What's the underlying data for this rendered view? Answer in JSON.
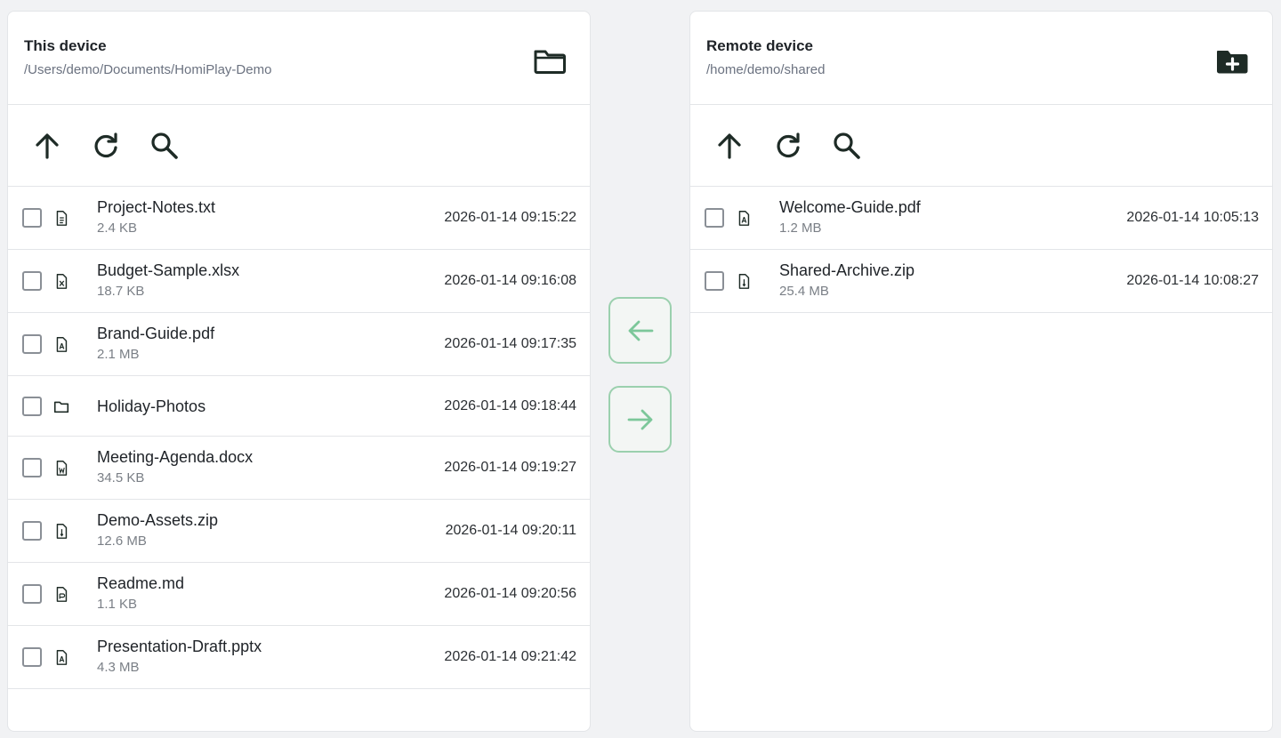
{
  "local": {
    "title": "This device",
    "path": "/Users/demo/Documents/HomiPlay-Demo",
    "files": [
      {
        "name": "Project-Notes.txt",
        "size": "2.4 KB",
        "date": "2026-01-14 09:15:22",
        "icon": "text-file-icon"
      },
      {
        "name": "Budget-Sample.xlsx",
        "size": "18.7 KB",
        "date": "2026-01-14 09:16:08",
        "icon": "spreadsheet-file-icon"
      },
      {
        "name": "Brand-Guide.pdf",
        "size": "2.1 MB",
        "date": "2026-01-14 09:17:35",
        "icon": "pdf-file-icon"
      },
      {
        "name": "Holiday-Photos",
        "size": "",
        "date": "2026-01-14 09:18:44",
        "icon": "folder-icon"
      },
      {
        "name": "Meeting-Agenda.docx",
        "size": "34.5 KB",
        "date": "2026-01-14 09:19:27",
        "icon": "word-file-icon"
      },
      {
        "name": "Demo-Assets.zip",
        "size": "12.6 MB",
        "date": "2026-01-14 09:20:11",
        "icon": "zip-file-icon"
      },
      {
        "name": "Readme.md",
        "size": "1.1 KB",
        "date": "2026-01-14 09:20:56",
        "icon": "markdown-file-icon"
      },
      {
        "name": "Presentation-Draft.pptx",
        "size": "4.3 MB",
        "date": "2026-01-14 09:21:42",
        "icon": "pdf-file-icon"
      }
    ]
  },
  "remote": {
    "title": "Remote device",
    "path": "/home/demo/shared",
    "files": [
      {
        "name": "Welcome-Guide.pdf",
        "size": "1.2 MB",
        "date": "2026-01-14 10:05:13",
        "icon": "pdf-file-icon"
      },
      {
        "name": "Shared-Archive.zip",
        "size": "25.4 MB",
        "date": "2026-01-14 10:08:27",
        "icon": "zip-file-icon"
      }
    ]
  },
  "icons": {
    "header_local": "folder-open-icon",
    "header_remote": "create-folder-icon",
    "up": "arrow-up-icon",
    "refresh": "refresh-icon",
    "search": "search-icon",
    "to_local": "arrow-left-icon",
    "to_remote": "arrow-right-icon"
  },
  "colors": {
    "accent": "#7cc79a",
    "accent_border": "#9bd0ae",
    "icon_dark": "#1e2b26"
  }
}
